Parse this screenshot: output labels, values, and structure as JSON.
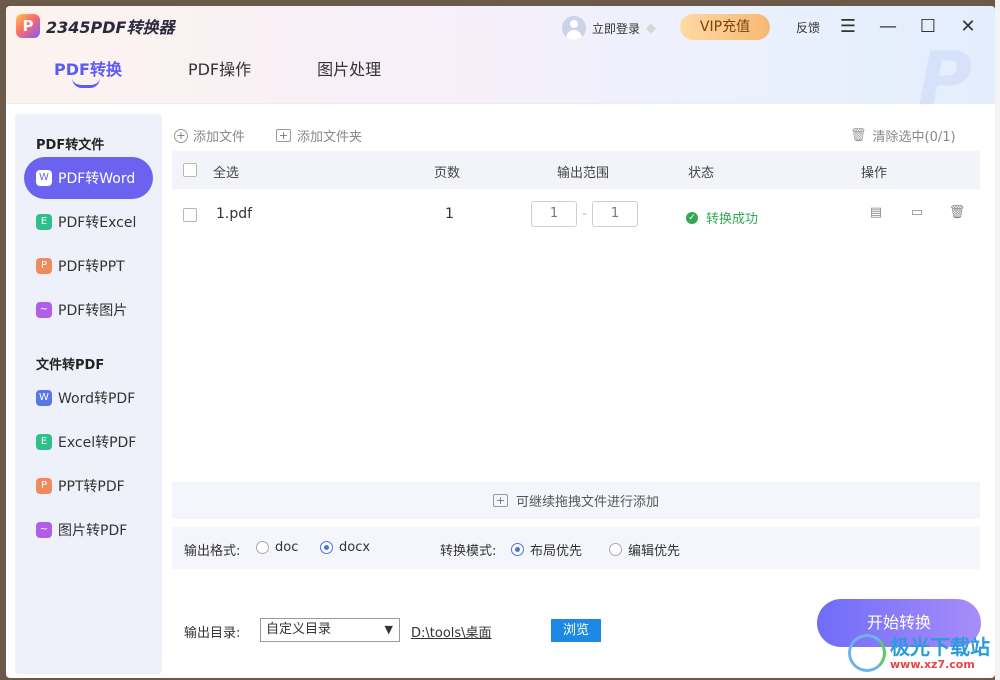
{
  "app": {
    "name": "2345PDF转换器",
    "logo_glyph": "P",
    "login_label": "立即登录",
    "vip_label": "VIP充值",
    "feedback_label": "反馈",
    "window_buttons": {
      "menu": "☰",
      "minimize": "—",
      "maximize": "☐",
      "close": "✕"
    }
  },
  "tabs": [
    {
      "label": "PDF转换",
      "active": true
    },
    {
      "label": "PDF操作",
      "active": false
    },
    {
      "label": "图片处理",
      "active": false
    }
  ],
  "sidebar": {
    "group1_title": "PDF转文件",
    "group1_items": [
      {
        "label": "PDF转Word",
        "glyph": "W",
        "color": "#5b76e8",
        "active": true
      },
      {
        "label": "PDF转Excel",
        "glyph": "E",
        "color": "#2fbf8a",
        "active": false
      },
      {
        "label": "PDF转PPT",
        "glyph": "P",
        "color": "#f08a5d",
        "active": false
      },
      {
        "label": "PDF转图片",
        "glyph": "~",
        "color": "#b25de8",
        "active": false
      }
    ],
    "group2_title": "文件转PDF",
    "group2_items": [
      {
        "label": "Word转PDF",
        "glyph": "W",
        "color": "#5b76e8"
      },
      {
        "label": "Excel转PDF",
        "glyph": "E",
        "color": "#2fbf8a"
      },
      {
        "label": "PPT转PDF",
        "glyph": "P",
        "color": "#f08a5d"
      },
      {
        "label": "图片转PDF",
        "glyph": "~",
        "color": "#b25de8"
      }
    ]
  },
  "toolbar": {
    "add_file": "添加文件",
    "add_folder": "添加文件夹",
    "clear_selected": "清除选中(0/1)"
  },
  "table": {
    "headers": {
      "select_all": "全选",
      "pages": "页数",
      "range": "输出范围",
      "status": "状态",
      "actions": "操作"
    },
    "rows": [
      {
        "name": "1.pdf",
        "pages": "1",
        "range_from": "1",
        "range_to": "1",
        "range_sep": "-",
        "status": "转换成功"
      }
    ]
  },
  "drop_hint": "可继续拖拽文件进行添加",
  "options": {
    "format_label": "输出格式:",
    "formats": [
      {
        "label": "doc",
        "checked": false
      },
      {
        "label": "docx",
        "checked": true
      }
    ],
    "mode_label": "转换模式:",
    "modes": [
      {
        "label": "布局优先",
        "checked": true
      },
      {
        "label": "编辑优先",
        "checked": false
      }
    ]
  },
  "output": {
    "dir_label": "输出目录:",
    "dir_select": "自定义目录",
    "path": "D:\\tools\\桌面",
    "browse": "浏览"
  },
  "start_button": "开始转换",
  "watermark": {
    "text": "极光下载站",
    "url": "www.xz7.com"
  }
}
